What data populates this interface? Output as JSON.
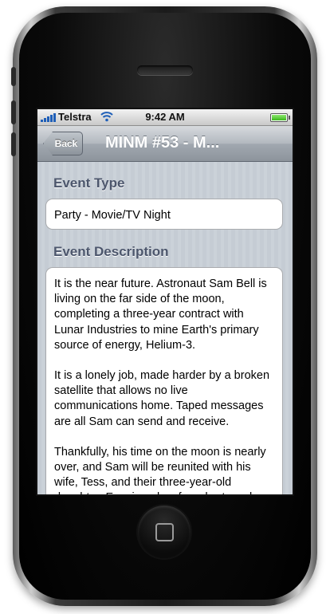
{
  "status_bar": {
    "carrier": "Telstra",
    "time": "9:42 AM"
  },
  "nav": {
    "back_label": "Back",
    "title": "MINM #53 - M..."
  },
  "event_type": {
    "header": "Event Type",
    "value": "Party - Movie/TV Night"
  },
  "event_description": {
    "header": "Event Description",
    "paragraphs": [
      "It is the near future. Astronaut Sam Bell is living on the far side of the moon, completing a three-year contract with Lunar Industries to mine Earth's primary source of energy, Helium-3.",
      "It is a lonely job, made harder by a broken satellite that allows no live communications home. Taped messages are all Sam can send and receive.",
      "Thankfully, his time on the moon is nearly over, and Sam will be reunited with his wife, Tess, and their three-year-old daughter, Eve, in only a few short weeks."
    ]
  },
  "icons": {
    "signal": "signal-bars-icon",
    "wifi": "wifi-icon",
    "battery": "battery-icon",
    "home": "home-button-icon"
  },
  "colors": {
    "nav_bar": "#a1a8b0",
    "section_header": "#4c566c",
    "signal_blue": "#1f5fb8",
    "battery_green": "#3cb81d"
  }
}
